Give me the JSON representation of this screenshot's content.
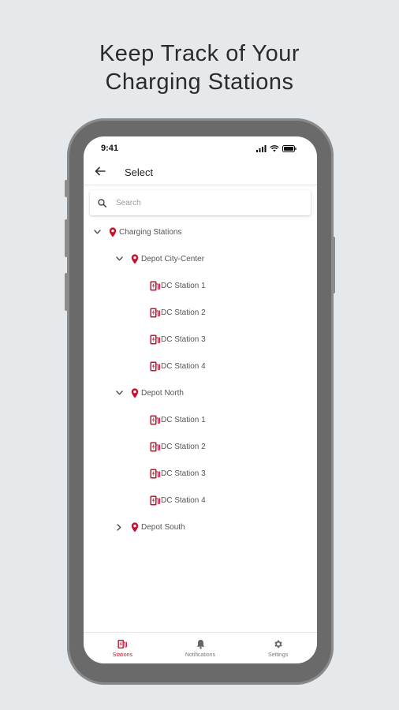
{
  "headline": {
    "line1": "Keep Track of Your",
    "line2": "Charging Stations"
  },
  "status_bar": {
    "time": "9:41"
  },
  "app_bar": {
    "title": "Select",
    "back_icon": "arrow-left-icon"
  },
  "search": {
    "placeholder": "Search"
  },
  "tree": {
    "root": {
      "label": "Charging Stations",
      "expanded": true
    },
    "depots": [
      {
        "label": "Depot City-Center",
        "expanded": true,
        "stations": [
          "DC Station 1",
          "DC Station 2",
          "DC Station 3",
          "DC Station 4"
        ]
      },
      {
        "label": "Depot North",
        "expanded": true,
        "stations": [
          "DC Station 1",
          "DC Station 2",
          "DC Station 3",
          "DC Station 4"
        ]
      },
      {
        "label": "Depot South",
        "expanded": false,
        "stations": []
      }
    ]
  },
  "tab_bar": {
    "tabs": [
      {
        "label": "Stations",
        "icon": "charger-icon",
        "active": true
      },
      {
        "label": "Notifications",
        "icon": "bell-icon",
        "active": false
      },
      {
        "label": "Settings",
        "icon": "gear-icon",
        "active": false
      }
    ]
  },
  "colors": {
    "accent": "#c8102e",
    "background": "#e6e9ec",
    "phone_frame": "#6a6a6a"
  }
}
